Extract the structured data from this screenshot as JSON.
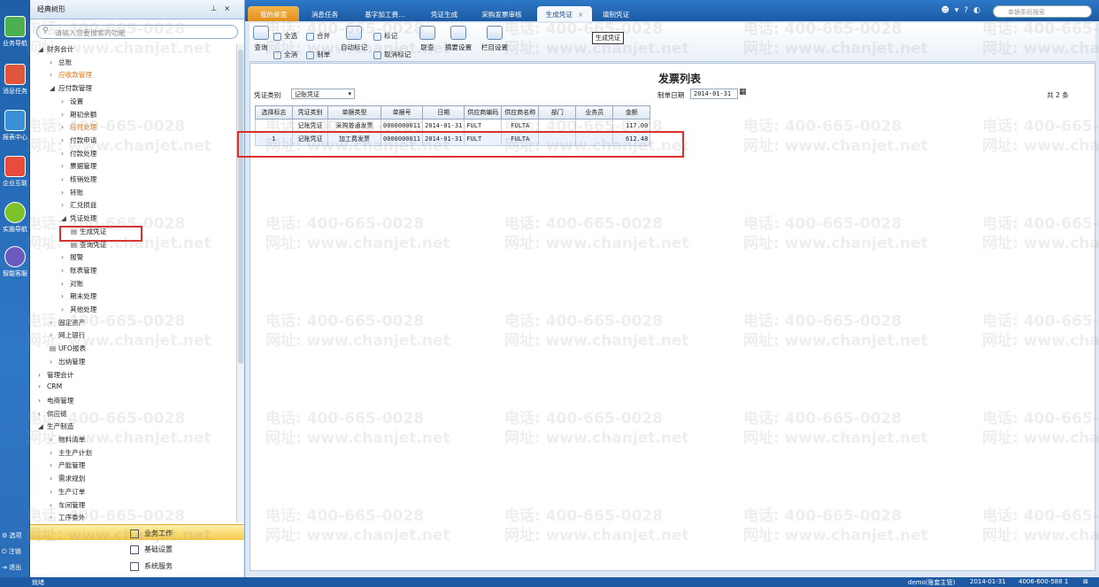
{
  "leftbar": {
    "items": [
      "业务导航",
      "消息任务",
      "报表中心",
      "企业互联",
      "实施导航",
      "智能客服"
    ],
    "bottom": [
      "选项",
      "注销",
      "退出"
    ]
  },
  "panel": {
    "title": "经典树形",
    "search_placeholder": "请输入您要搜索的功能",
    "tree": [
      {
        "label": "财务会计",
        "level": 1,
        "expanded": true
      },
      {
        "label": "总账",
        "level": 2,
        "expanded": false
      },
      {
        "label": "应收款管理",
        "level": 2,
        "expanded": false,
        "highlight": true
      },
      {
        "label": "应付款管理",
        "level": 2,
        "expanded": true
      },
      {
        "label": "设置",
        "level": 3,
        "expanded": false
      },
      {
        "label": "期初余额",
        "level": 3,
        "expanded": false
      },
      {
        "label": "应付处理",
        "level": 3,
        "expanded": false,
        "highlight": true
      },
      {
        "label": "付款申请",
        "level": 3,
        "expanded": false
      },
      {
        "label": "付款处理",
        "level": 3,
        "expanded": false
      },
      {
        "label": "票据管理",
        "level": 3,
        "expanded": false
      },
      {
        "label": "核销处理",
        "level": 3,
        "expanded": false
      },
      {
        "label": "转账",
        "level": 3,
        "expanded": false
      },
      {
        "label": "汇兑损益",
        "level": 3,
        "expanded": false
      },
      {
        "label": "凭证处理",
        "level": 3,
        "expanded": true
      },
      {
        "label": "生成凭证",
        "level": 4,
        "leaf": true
      },
      {
        "label": "查询凭证",
        "level": 4,
        "leaf": true
      },
      {
        "label": "报警",
        "level": 3,
        "expanded": false
      },
      {
        "label": "账表管理",
        "level": 3,
        "expanded": false
      },
      {
        "label": "对账",
        "level": 3,
        "expanded": false
      },
      {
        "label": "期末处理",
        "level": 3,
        "expanded": false
      },
      {
        "label": "其他处理",
        "level": 3,
        "expanded": false
      },
      {
        "label": "固定资产",
        "level": 2,
        "expanded": false
      },
      {
        "label": "网上银行",
        "level": 2,
        "expanded": false
      },
      {
        "label": "UFO报表",
        "level": 2,
        "leaf": true
      },
      {
        "label": "出纳管理",
        "level": 2,
        "expanded": false
      },
      {
        "label": "管理会计",
        "level": 1,
        "expanded": false
      },
      {
        "label": "CRM",
        "level": 1,
        "expanded": false
      },
      {
        "label": "电商管理",
        "level": 1,
        "expanded": false
      },
      {
        "label": "供应链",
        "level": 1,
        "expanded": false
      },
      {
        "label": "生产制造",
        "level": 1,
        "expanded": true
      },
      {
        "label": "物料清单",
        "level": 2,
        "expanded": false
      },
      {
        "label": "主生产计划",
        "level": 2,
        "expanded": false
      },
      {
        "label": "产能管理",
        "level": 2,
        "expanded": false
      },
      {
        "label": "需求规划",
        "level": 2,
        "expanded": false
      },
      {
        "label": "生产订单",
        "level": 2,
        "expanded": false
      },
      {
        "label": "车间管理",
        "level": 2,
        "expanded": false
      },
      {
        "label": "工序委外",
        "level": 2,
        "expanded": false
      }
    ],
    "bottom_buttons": [
      "业务工作",
      "基础设置",
      "系统服务"
    ]
  },
  "tabs": [
    "我的桌面",
    "消息任务",
    "基字加工费…",
    "凭证生成",
    "采购发票审核",
    "生成凭证",
    "填制凭证"
  ],
  "top_search_placeholder": "单据条码搜索",
  "toolbar": {
    "query": "查询",
    "select_all": "全选",
    "deselect_all": "全消",
    "merge": "合并",
    "make": "制单",
    "auto_mark": "自动标记",
    "mark": "标记",
    "unmark": "取消标记",
    "link": "联查",
    "summary_settings": "摘要设置",
    "column_settings": "栏目设置"
  },
  "tooltip": "生成凭证",
  "content": {
    "title": "发票列表",
    "voucher_type_label": "凭证类别",
    "voucher_type_value": "记账凭证",
    "date_label": "制单日期",
    "date_value": "2014-01-31",
    "count_text": "共 2 条",
    "columns": [
      "选择标志",
      "凭证类别",
      "单据类型",
      "单据号",
      "日期",
      "供应商编码",
      "供应商名称",
      "部门",
      "业务员",
      "金额"
    ],
    "rows": [
      [
        "",
        "记账凭证",
        "采购普通发票",
        "0000000011",
        "2014-01-31",
        "FULT",
        "FULTA",
        "",
        "",
        "117.00"
      ],
      [
        "1",
        "记账凭证",
        "加工费发票",
        "0000000011",
        "2014-01-31",
        "FULT",
        "FULTA",
        "",
        "",
        "612.48"
      ]
    ]
  },
  "status": {
    "left": "就绪",
    "user": "demo(账套主管)",
    "date": "2014-01-31",
    "phone": "4006-600-588 1"
  },
  "watermark": {
    "phone": "电话: 400-665-0028",
    "site": "网址: www.chanjet.net"
  },
  "colors": {
    "accent": "#1c5aa3",
    "home_tab": "#e08d1d",
    "highlight": "#e3741a",
    "redbox": "#d9302c"
  }
}
